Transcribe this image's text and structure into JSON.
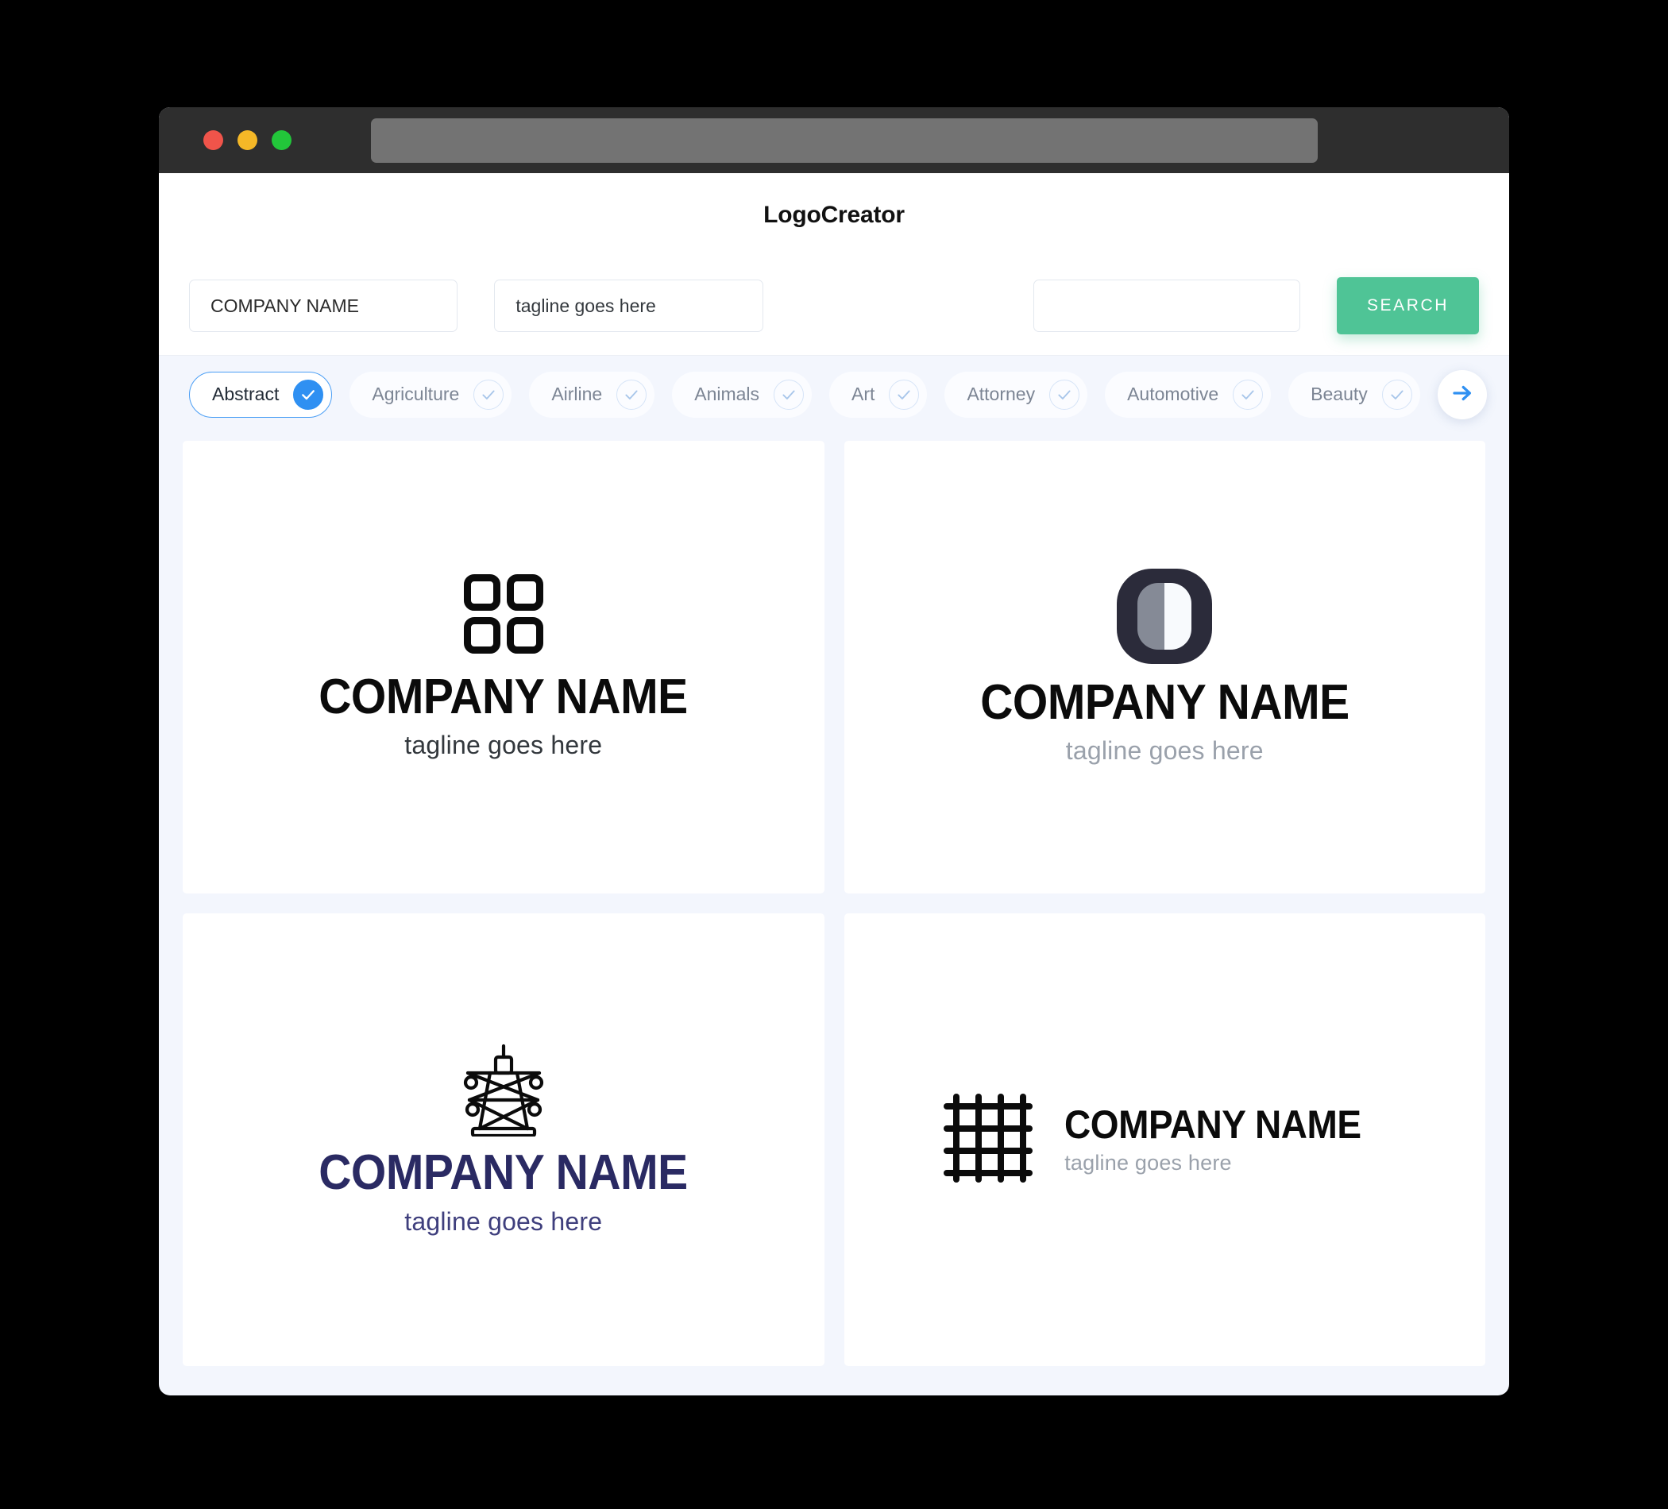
{
  "window": {
    "traffic_lights": [
      {
        "name": "close",
        "color": "#f0544a"
      },
      {
        "name": "minimize",
        "color": "#f5b827"
      },
      {
        "name": "maximize",
        "color": "#22c63a"
      }
    ],
    "address_bar_value": ""
  },
  "header": {
    "title": "LogoCreator"
  },
  "search": {
    "company_value": "COMPANY NAME",
    "company_placeholder": "COMPANY NAME",
    "tagline_value": "tagline goes here",
    "tagline_placeholder": "tagline goes here",
    "extra_value": "",
    "extra_placeholder": "",
    "button_label": "SEARCH",
    "button_color": "#4fc496"
  },
  "categories": {
    "next_icon": "arrow-right-icon",
    "items": [
      {
        "label": "Abstract",
        "selected": true
      },
      {
        "label": "Agriculture",
        "selected": false
      },
      {
        "label": "Airline",
        "selected": false
      },
      {
        "label": "Animals",
        "selected": false
      },
      {
        "label": "Art",
        "selected": false
      },
      {
        "label": "Attorney",
        "selected": false
      },
      {
        "label": "Automotive",
        "selected": false
      },
      {
        "label": "Beauty",
        "selected": false
      }
    ],
    "selected_color": "#2f90f2"
  },
  "results": [
    {
      "mark": "four-rounded-squares-icon",
      "name": "COMPANY NAME",
      "tagline": "tagline goes here",
      "name_color": "#0b0b0b",
      "tagline_color": "#33383d",
      "layout": "stacked"
    },
    {
      "mark": "split-circle-icon",
      "name": "COMPANY NAME",
      "tagline": "tagline goes here",
      "name_color": "#0b0b0b",
      "tagline_color": "#9aa1ab",
      "layout": "stacked"
    },
    {
      "mark": "transmission-tower-icon",
      "name": "COMPANY NAME",
      "tagline": "tagline goes here",
      "name_color": "#2a2a63",
      "tagline_color": "#3f3f7d",
      "layout": "stacked"
    },
    {
      "mark": "grid-lattice-icon",
      "name": "COMPANY NAME",
      "tagline": "tagline goes here",
      "name_color": "#0b0b0b",
      "tagline_color": "#9aa1ab",
      "layout": "horizontal"
    }
  ]
}
